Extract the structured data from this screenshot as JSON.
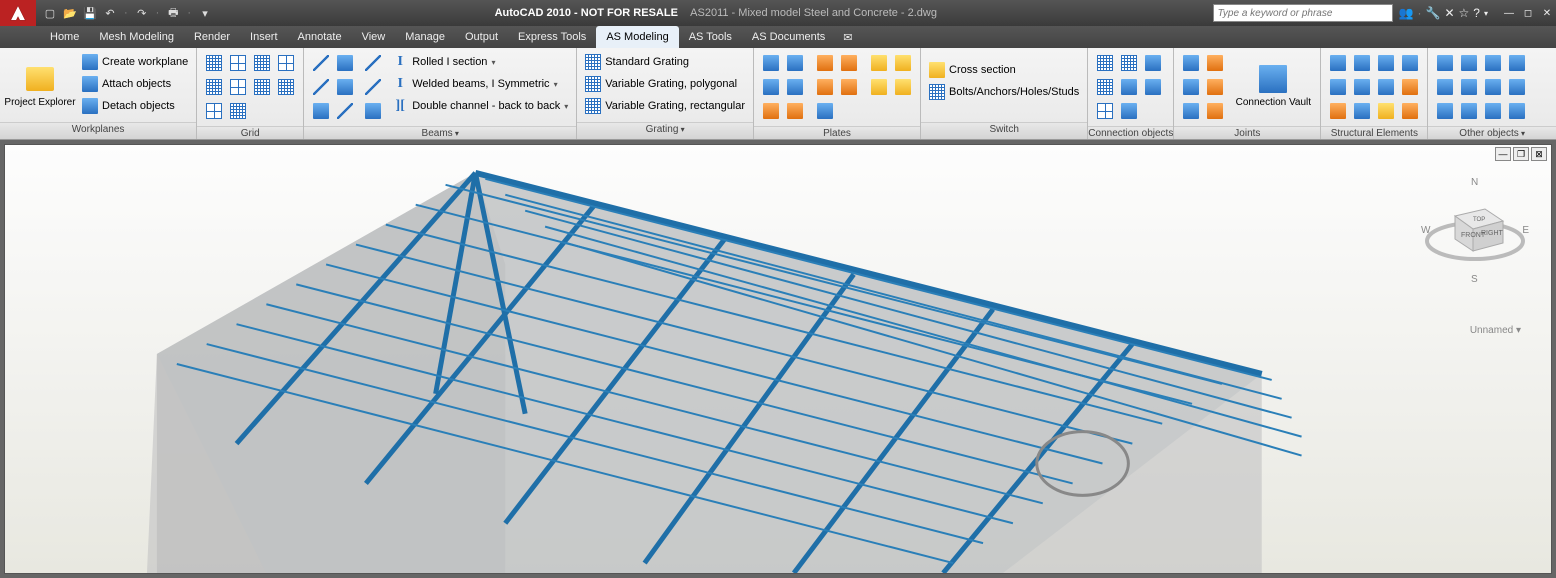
{
  "title": {
    "app": "AutoCAD 2010 - NOT FOR RESALE",
    "doc": "AS2011 - Mixed model Steel and Concrete - 2.dwg"
  },
  "search": {
    "placeholder": "Type a keyword or phrase"
  },
  "menu_tabs": [
    "Home",
    "Mesh Modeling",
    "Render",
    "Insert",
    "Annotate",
    "View",
    "Manage",
    "Output",
    "Express Tools",
    "AS Modeling",
    "AS Tools",
    "AS Documents"
  ],
  "active_tab": "AS Modeling",
  "panels": {
    "workplanes": {
      "title": "Workplanes",
      "big": "Project Explorer",
      "items": [
        "Create workplane",
        "Attach objects",
        "Detach objects"
      ]
    },
    "grid": {
      "title": "Grid"
    },
    "beams": {
      "title": "Beams",
      "items": [
        "Rolled I section",
        "Welded beams, I Symmetric",
        "Double channel - back to back"
      ]
    },
    "grating": {
      "title": "Grating",
      "items": [
        "Standard Grating",
        "Variable Grating, polygonal",
        "Variable Grating, rectangular"
      ]
    },
    "plates": {
      "title": "Plates"
    },
    "switch": {
      "title": "Switch",
      "items": [
        "Cross section",
        "Bolts/Anchors/Holes/Studs"
      ]
    },
    "connobj": {
      "title": "Connection objects"
    },
    "joints": {
      "title": "Joints",
      "big": "Connection Vault"
    },
    "structel": {
      "title": "Structural Elements"
    },
    "other": {
      "title": "Other objects"
    }
  },
  "viewcube": {
    "n": "N",
    "s": "S",
    "e": "E",
    "w": "W",
    "front": "FRONT",
    "right": "RIGHT",
    "top": "TOP"
  },
  "vp": {
    "unnamed": "Unnamed"
  }
}
